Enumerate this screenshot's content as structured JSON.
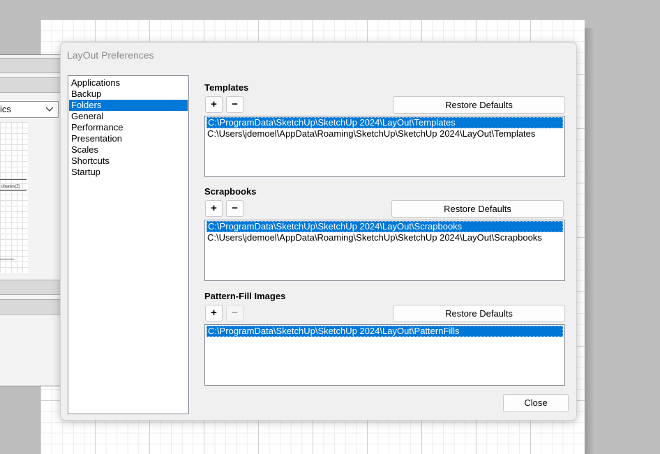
{
  "window": {
    "title": "LayOut Preferences"
  },
  "background_panel": {
    "dropdown_value": "ics",
    "preview_caption": "dinates(Z)"
  },
  "categories": [
    {
      "label": "Applications",
      "selected": false
    },
    {
      "label": "Backup",
      "selected": false
    },
    {
      "label": "Folders",
      "selected": true
    },
    {
      "label": "General",
      "selected": false
    },
    {
      "label": "Performance",
      "selected": false
    },
    {
      "label": "Presentation",
      "selected": false
    },
    {
      "label": "Scales",
      "selected": false
    },
    {
      "label": "Shortcuts",
      "selected": false
    },
    {
      "label": "Startup",
      "selected": false
    }
  ],
  "sections": {
    "templates": {
      "title": "Templates",
      "add_label": "+",
      "remove_label": "−",
      "remove_enabled": true,
      "restore_label": "Restore Defaults",
      "paths": [
        "C:\\ProgramData\\SketchUp\\SketchUp 2024\\LayOut\\Templates",
        "C:\\Users\\jdemoel\\AppData\\Roaming\\SketchUp\\SketchUp 2024\\LayOut\\Templates"
      ],
      "selected_index": 0
    },
    "scrapbooks": {
      "title": "Scrapbooks",
      "add_label": "+",
      "remove_label": "−",
      "remove_enabled": true,
      "restore_label": "Restore Defaults",
      "paths": [
        "C:\\ProgramData\\SketchUp\\SketchUp 2024\\LayOut\\Scrapbooks",
        "C:\\Users\\jdemoel\\AppData\\Roaming\\SketchUp\\SketchUp 2024\\LayOut\\Scrapbooks"
      ],
      "selected_index": 0
    },
    "pattern_fill": {
      "title": "Pattern-Fill Images",
      "add_label": "+",
      "remove_label": "−",
      "remove_enabled": false,
      "restore_label": "Restore Defaults",
      "paths": [
        "C:\\ProgramData\\SketchUp\\SketchUp 2024\\LayOut\\PatternFills"
      ],
      "selected_index": 0
    }
  },
  "footer": {
    "close_label": "Close"
  },
  "colors": {
    "selection": "#0078d7",
    "dialog_bg": "#f0f0f0",
    "title_text": "#8a8a8a"
  },
  "icons": {
    "dropdown": "chevron-down-icon"
  }
}
